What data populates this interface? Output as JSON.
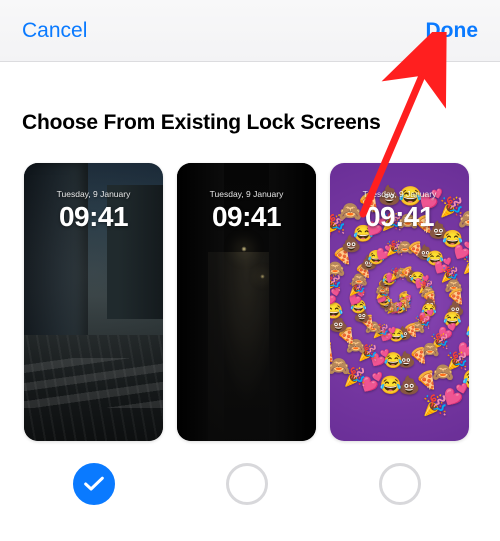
{
  "nav": {
    "cancel_label": "Cancel",
    "done_label": "Done"
  },
  "heading": "Choose From Existing Lock Screens",
  "lockscreen_date": "Tuesday, 9 January",
  "lockscreen_time": "09:41",
  "screens": [
    {
      "selected": true,
      "theme": "city"
    },
    {
      "selected": false,
      "theme": "night"
    },
    {
      "selected": false,
      "theme": "emoji"
    }
  ],
  "colors": {
    "accent": "#0a7aff",
    "arrow": "#ff1f1f"
  },
  "emoji_palette": [
    "🍕",
    "💩",
    "😂",
    "💕",
    "🎉",
    "🙈"
  ]
}
